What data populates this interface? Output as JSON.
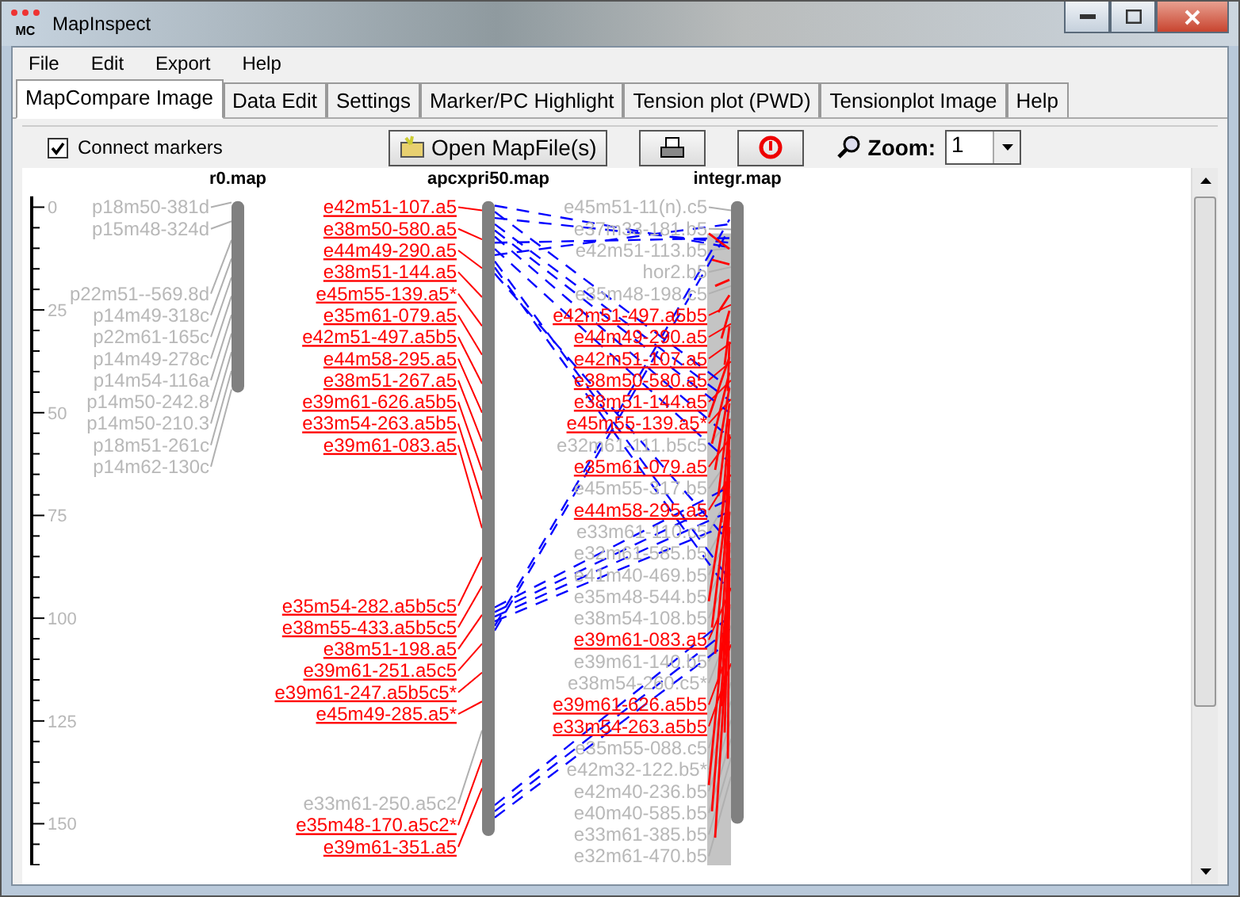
{
  "window": {
    "title": "MapInspect",
    "icon_text": "MC"
  },
  "menu": [
    "File",
    "Edit",
    "Export",
    "Help"
  ],
  "tabs": [
    {
      "label": "MapCompare Image",
      "selected": true
    },
    {
      "label": "Data Edit",
      "selected": false
    },
    {
      "label": "Settings",
      "selected": false
    },
    {
      "label": "Marker/PC Highlight",
      "selected": false
    },
    {
      "label": "Tension plot (PWD)",
      "selected": false
    },
    {
      "label": "Tensionplot Image",
      "selected": false
    },
    {
      "label": "Help",
      "selected": false
    }
  ],
  "toolbar": {
    "connect_markers": {
      "label": "Connect markers",
      "checked": true
    },
    "open_button": "Open MapFile(s)",
    "zoom": {
      "label": "Zoom:",
      "value": "1"
    }
  },
  "axis": {
    "ticks": [
      "0",
      "25",
      "50",
      "75",
      "100",
      "125",
      "150"
    ]
  },
  "maps": [
    {
      "title": "r0.map",
      "markers": [
        {
          "name": "p18m50-381d",
          "highlighted": false
        },
        {
          "name": "p15m48-324d",
          "highlighted": false
        },
        {
          "name": "p22m51--569.8d",
          "highlighted": false
        },
        {
          "name": "p14m49-318c",
          "highlighted": false
        },
        {
          "name": "p22m61-165c",
          "highlighted": false
        },
        {
          "name": "p14m49-278c",
          "highlighted": false
        },
        {
          "name": "p14m54-116a",
          "highlighted": false
        },
        {
          "name": "p14m50-242.8",
          "highlighted": false
        },
        {
          "name": "p14m50-210.3",
          "highlighted": false
        },
        {
          "name": "p18m51-261c",
          "highlighted": false
        },
        {
          "name": "p14m62-130c",
          "highlighted": false
        }
      ]
    },
    {
      "title": "apcxpri50.map",
      "markers": [
        {
          "name": "e42m51-107.a5",
          "highlighted": true
        },
        {
          "name": "e38m50-580.a5",
          "highlighted": true
        },
        {
          "name": "e44m49-290.a5",
          "highlighted": true
        },
        {
          "name": "e38m51-144.a5",
          "highlighted": true
        },
        {
          "name": "e45m55-139.a5*",
          "highlighted": true
        },
        {
          "name": "e35m61-079.a5",
          "highlighted": true
        },
        {
          "name": "e42m51-497.a5b5",
          "highlighted": true
        },
        {
          "name": "e44m58-295.a5",
          "highlighted": true
        },
        {
          "name": "e38m51-267.a5",
          "highlighted": true
        },
        {
          "name": "e39m61-626.a5b5",
          "highlighted": true
        },
        {
          "name": "e33m54-263.a5b5",
          "highlighted": true
        },
        {
          "name": "e39m61-083.a5",
          "highlighted": true
        },
        {
          "name": "e35m54-282.a5b5c5",
          "highlighted": true
        },
        {
          "name": "e38m55-433.a5b5c5",
          "highlighted": true
        },
        {
          "name": "e38m51-198.a5",
          "highlighted": true
        },
        {
          "name": "e39m61-251.a5c5",
          "highlighted": true
        },
        {
          "name": "e39m61-247.a5b5c5*",
          "highlighted": true
        },
        {
          "name": "e45m49-285.a5*",
          "highlighted": true
        },
        {
          "name": "e33m61-250.a5c2",
          "highlighted": false
        },
        {
          "name": "e35m48-170.a5c2*",
          "highlighted": true
        },
        {
          "name": "e39m61-351.a5",
          "highlighted": true
        }
      ]
    },
    {
      "title": "integr.map",
      "markers": [
        {
          "name": "e45m51-11(n).c5",
          "highlighted": false
        },
        {
          "name": "e37m33-181.b5",
          "highlighted": false
        },
        {
          "name": "e42m51-113.b5",
          "highlighted": false
        },
        {
          "name": "hor2.b5",
          "highlighted": false
        },
        {
          "name": "e35m48-198.c5",
          "highlighted": false
        },
        {
          "name": "e42m51-497.a5b5",
          "highlighted": true
        },
        {
          "name": "e44m49-290.a5",
          "highlighted": true
        },
        {
          "name": "e42m51-107.a5",
          "highlighted": true
        },
        {
          "name": "e38m50-580.a5",
          "highlighted": true
        },
        {
          "name": "e38m51-144.a5",
          "highlighted": true
        },
        {
          "name": "e45m55-139.a5*",
          "highlighted": true
        },
        {
          "name": "e32m61-111.b5c5",
          "highlighted": false
        },
        {
          "name": "e35m61-079.a5",
          "highlighted": true
        },
        {
          "name": "e45m55-317.b5",
          "highlighted": false
        },
        {
          "name": "e44m58-295.a5",
          "highlighted": true
        },
        {
          "name": "e33m61-110.c5",
          "highlighted": false
        },
        {
          "name": "e32m61-585.b5",
          "highlighted": false
        },
        {
          "name": "e41m40-469.b5",
          "highlighted": false
        },
        {
          "name": "e35m48-544.b5",
          "highlighted": false
        },
        {
          "name": "e38m54-108.b5",
          "highlighted": false
        },
        {
          "name": "e39m61-083.a5",
          "highlighted": true
        },
        {
          "name": "e39m61-140.b5",
          "highlighted": false
        },
        {
          "name": "e38m54-260.c5*",
          "highlighted": false
        },
        {
          "name": "e39m61-626.a5b5",
          "highlighted": true
        },
        {
          "name": "e33m54-263.a5b5",
          "highlighted": true
        },
        {
          "name": "e35m55-088.c5",
          "highlighted": false
        },
        {
          "name": "e42m32-122.b5*",
          "highlighted": false
        },
        {
          "name": "e42m40-236.b5",
          "highlighted": false
        },
        {
          "name": "e40m40-585.b5",
          "highlighted": false
        },
        {
          "name": "e33m61-385.b5",
          "highlighted": false
        },
        {
          "name": "e32m61-470.b5",
          "highlighted": false
        }
      ]
    }
  ]
}
